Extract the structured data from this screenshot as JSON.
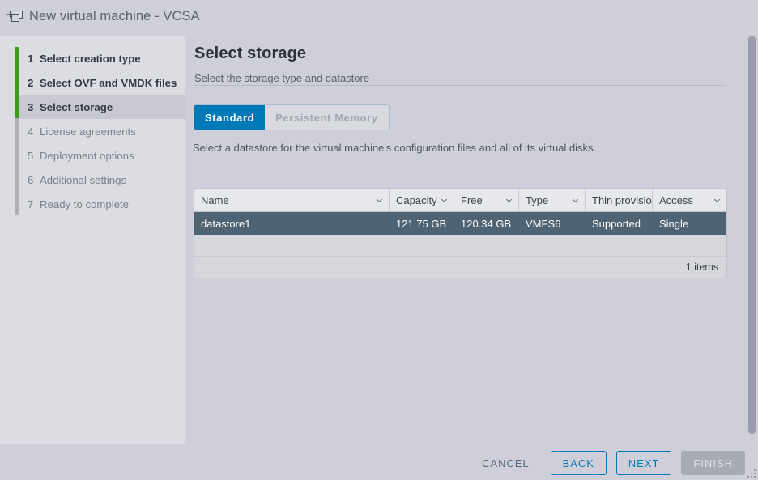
{
  "window": {
    "title": "New virtual machine - VCSA",
    "icon": "new-vm-icon"
  },
  "sidebar": {
    "steps": [
      {
        "num": "1",
        "label": "Select creation type",
        "state": "done"
      },
      {
        "num": "2",
        "label": "Select OVF and VMDK files",
        "state": "done"
      },
      {
        "num": "3",
        "label": "Select storage",
        "state": "active"
      },
      {
        "num": "4",
        "label": "License agreements",
        "state": "todo"
      },
      {
        "num": "5",
        "label": "Deployment options",
        "state": "todo"
      },
      {
        "num": "6",
        "label": "Additional settings",
        "state": "todo"
      },
      {
        "num": "7",
        "label": "Ready to complete",
        "state": "todo"
      }
    ],
    "progress_color": "#3e9c19",
    "rail_color": "#b0b0b8"
  },
  "content": {
    "title": "Select storage",
    "subtitle": "Select the storage type and datastore",
    "helper_text": "Select a datastore for the virtual machine's configuration files and all of its virtual disks.",
    "tabs": [
      {
        "label": "Standard",
        "state": "selected"
      },
      {
        "label": "Persistent Memory",
        "state": "disabled"
      }
    ],
    "accent_color": "#0079b8",
    "table": {
      "columns": [
        {
          "key": "name",
          "label": "Name",
          "sortable": true
        },
        {
          "key": "capacity",
          "label": "Capacity",
          "sortable": true
        },
        {
          "key": "free",
          "label": "Free",
          "sortable": true
        },
        {
          "key": "type",
          "label": "Type",
          "sortable": true
        },
        {
          "key": "thin",
          "label": "Thin provisio",
          "sortable": false
        },
        {
          "key": "access",
          "label": "Access",
          "sortable": true
        }
      ],
      "rows": [
        {
          "name": "datastore1",
          "capacity": "121.75 GB",
          "free": "120.34 GB",
          "type": "VMFS6",
          "thin": "Supported",
          "access": "Single",
          "selected": true
        }
      ],
      "footer_count": "1 items",
      "selected_row_color": "#4e6373"
    }
  },
  "footer": {
    "buttons": [
      {
        "label": "CANCEL",
        "style": "link",
        "enabled": true
      },
      {
        "label": "BACK",
        "style": "outline",
        "enabled": true
      },
      {
        "label": "NEXT",
        "style": "outline",
        "enabled": true
      },
      {
        "label": "FINISH",
        "style": "disabled",
        "enabled": false
      }
    ]
  }
}
